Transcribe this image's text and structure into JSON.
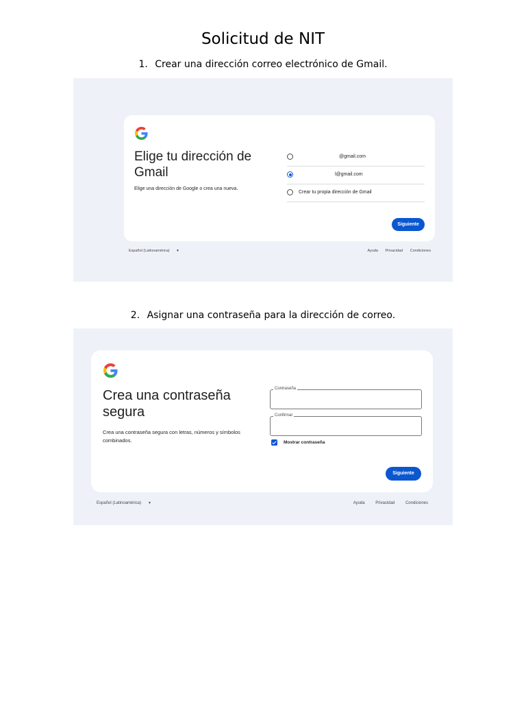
{
  "document": {
    "title": "Solicitud de NIT",
    "steps": [
      {
        "number": "1.",
        "text": "Crear una dirección correo electrónico de Gmail."
      },
      {
        "number": "2.",
        "text": "Asignar una contraseña para la dirección de correo."
      }
    ]
  },
  "screenshot1": {
    "headline_line1": "Elige tu dirección de",
    "headline_line2": "Gmail",
    "subtext": "Elige una dirección de Google o crea una nueva.",
    "options": [
      {
        "label": "@gmail.com",
        "selected": false
      },
      {
        "label": "l@gmail.com",
        "selected": true
      },
      {
        "label": "Crear tu propia dirección de Gmail",
        "selected": false
      }
    ],
    "next_label": "Siguiente",
    "footer": {
      "language": "Español (Latinoamérica)",
      "links": [
        "Ayuda",
        "Privacidad",
        "Condiciones"
      ]
    }
  },
  "screenshot2": {
    "headline_line1": "Crea una contraseña",
    "headline_line2": "segura",
    "subtext_line1": "Crea una contraseña segura con letras, números y símbolos",
    "subtext_line2": "combinados.",
    "password_label": "Contraseña",
    "confirm_label": "Confirmar",
    "show_password_label": "Mostrar contraseña",
    "show_password_checked": true,
    "next_label": "Siguiente",
    "footer": {
      "language": "Español (Latinoamérica)",
      "links": [
        "Ayuda",
        "Privacidad",
        "Condiciones"
      ]
    }
  },
  "colors": {
    "google_blue": "#0b57d0",
    "background": "#eef2f8"
  }
}
